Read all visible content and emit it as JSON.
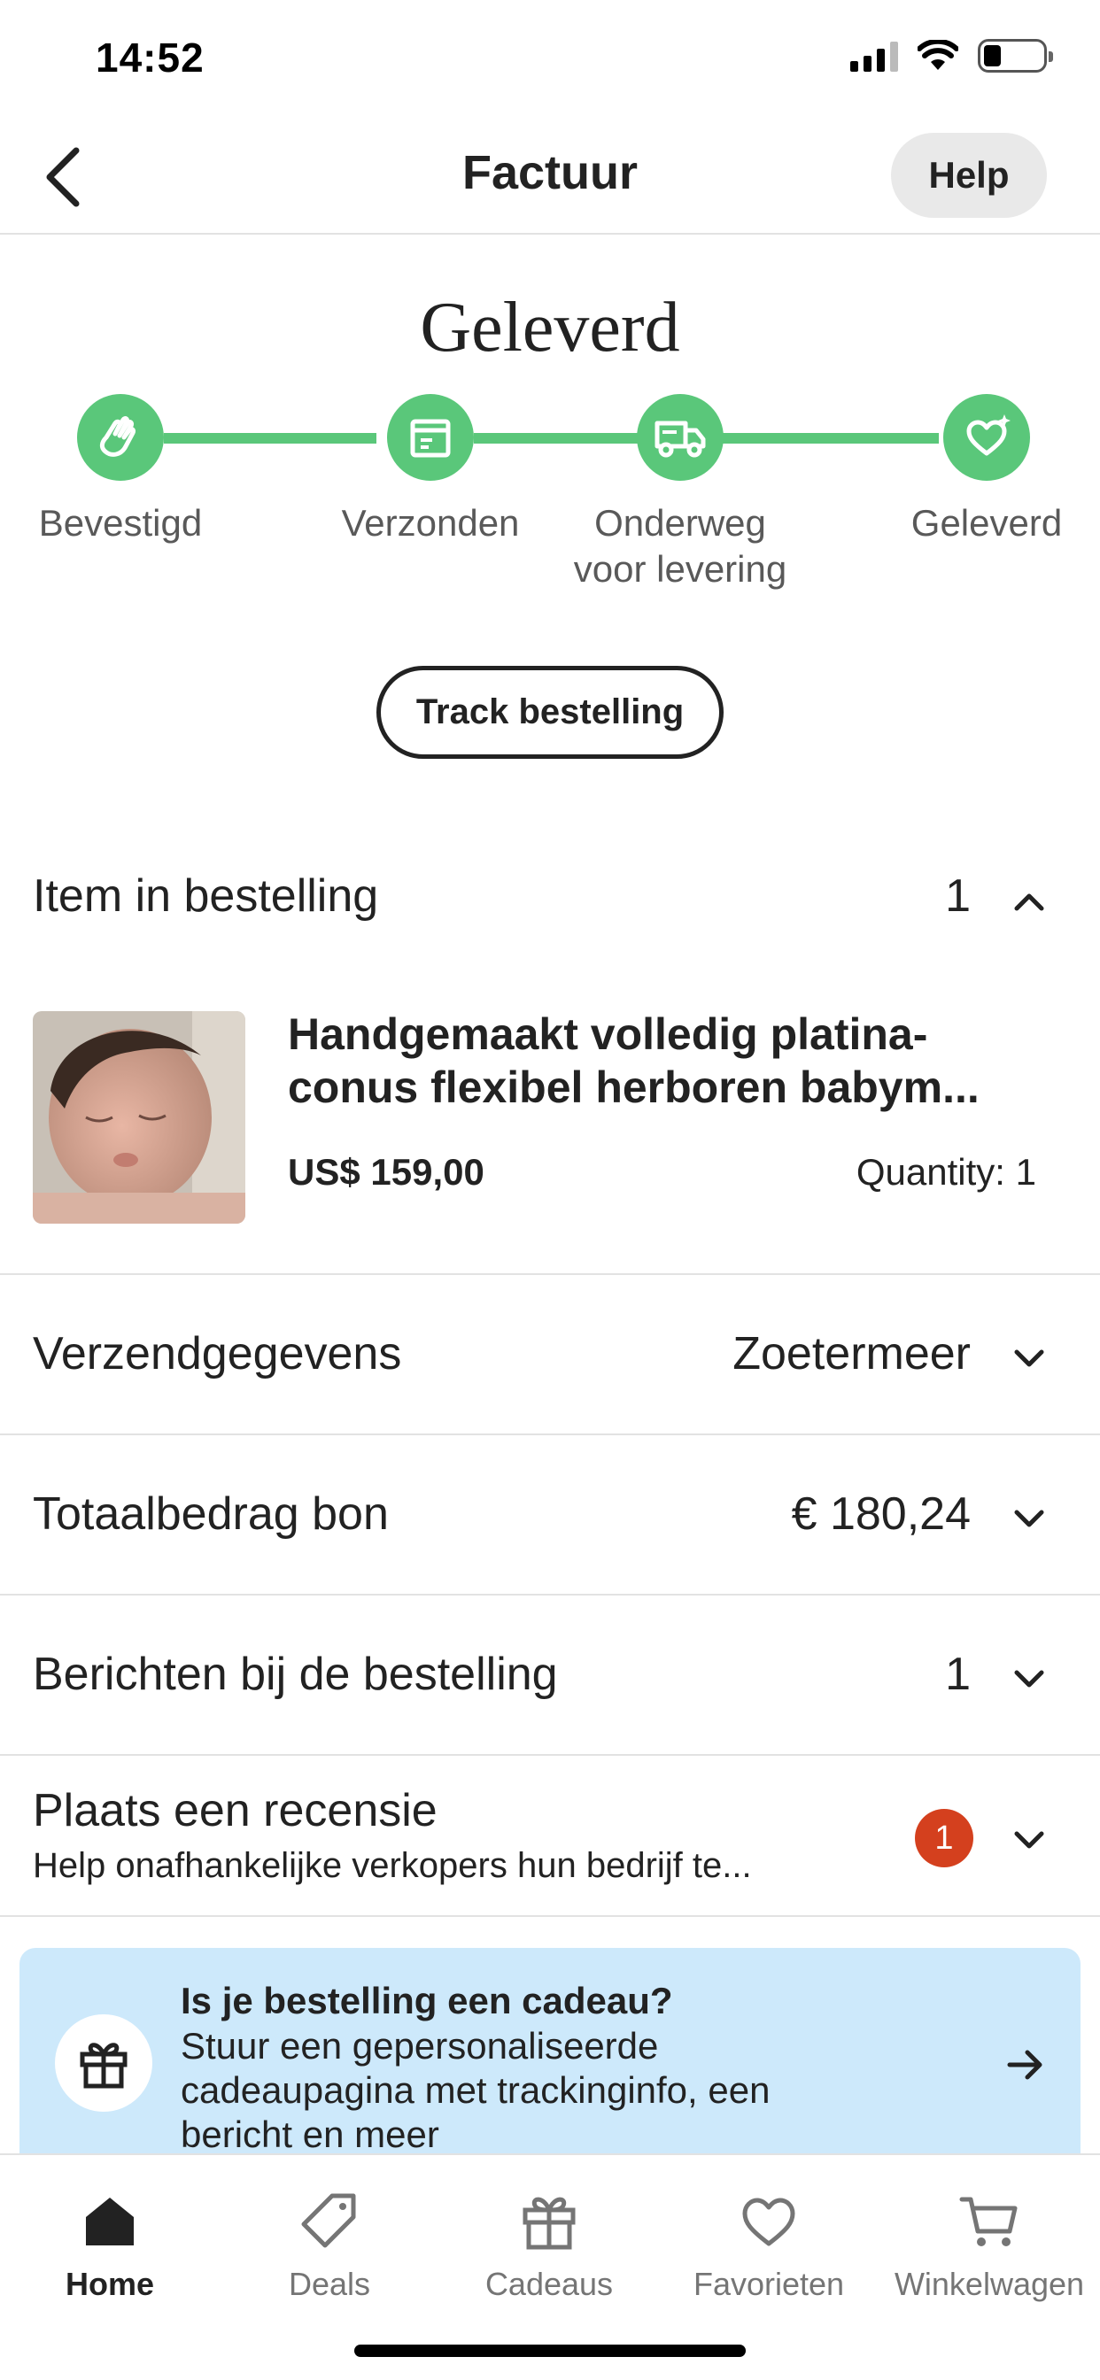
{
  "status_bar": {
    "time": "14:52"
  },
  "nav": {
    "title": "Factuur",
    "help_label": "Help"
  },
  "order_status": {
    "title": "Geleverd",
    "steps": [
      {
        "label": "Bevestigd",
        "icon": "waving-hand-icon"
      },
      {
        "label": "Verzonden",
        "icon": "package-icon"
      },
      {
        "label": "Onderweg voor levering",
        "label_line1": "Onderweg",
        "label_line2": "voor levering",
        "icon": "delivery-truck-icon"
      },
      {
        "label": "Geleverd",
        "icon": "heart-sparkle-icon"
      }
    ],
    "completed_steps": 4,
    "accent_color": "#5ac77a"
  },
  "track_button": {
    "label": "Track bestelling"
  },
  "items_section": {
    "label": "Item in bestelling",
    "count": "1"
  },
  "product": {
    "title": "Handgemaakt volledig platina-conus flexibel herboren babym...",
    "title_line1": "Handgemaakt volledig platina-",
    "title_line2": "conus flexibel herboren babym...",
    "price": "US$ 159,00",
    "quantity": "Quantity: 1"
  },
  "shipping": {
    "label": "Verzendgegevens",
    "value": "Zoetermeer"
  },
  "total": {
    "label": "Totaalbedrag bon",
    "value": "€ 180,24"
  },
  "messages": {
    "label": "Berichten bij de bestelling",
    "value": "1"
  },
  "review": {
    "title": "Plaats een recensie",
    "subtitle": "Help onafhankelijke verkopers hun bedrijf te...",
    "badge": "1",
    "badge_color": "#d4401e"
  },
  "gift_banner": {
    "title": "Is je bestelling een cadeau?",
    "text": "Stuur een gepersonaliseerde cadeaupagina met trackinginfo, een bericht en meer",
    "background": "#cde9fb"
  },
  "tab_bar": {
    "tabs": [
      {
        "label": "Home",
        "icon": "home-icon",
        "active": true
      },
      {
        "label": "Deals",
        "icon": "tag-icon",
        "active": false
      },
      {
        "label": "Cadeaus",
        "icon": "gift-icon",
        "active": false
      },
      {
        "label": "Favorieten",
        "icon": "heart-icon",
        "active": false
      },
      {
        "label": "Winkelwagen",
        "icon": "cart-icon",
        "active": false
      }
    ]
  }
}
